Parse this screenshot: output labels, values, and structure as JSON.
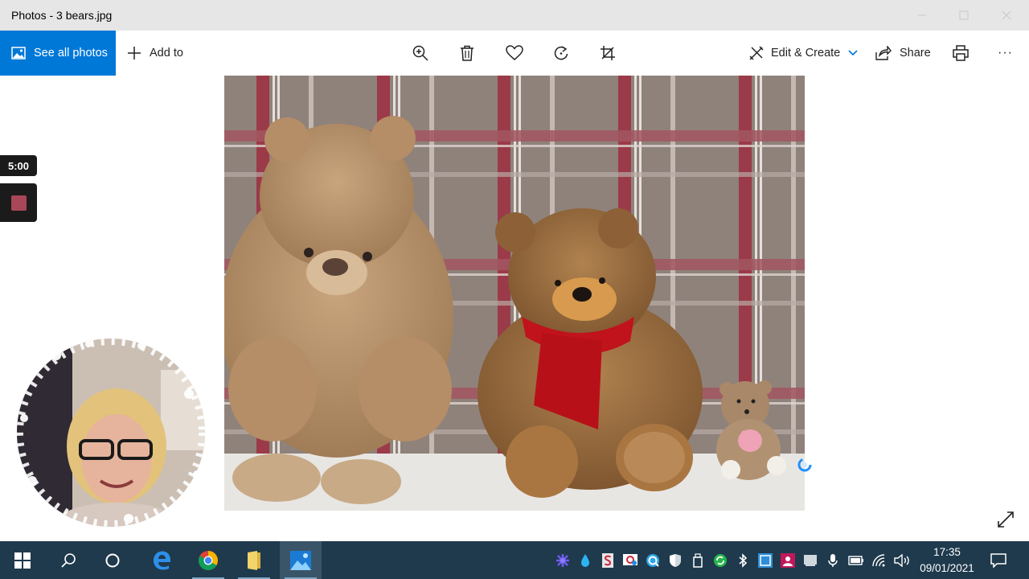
{
  "window": {
    "title": "Photos - 3 bears.jpg"
  },
  "toolbar": {
    "see_all_photos": "See all photos",
    "add_to": "Add to",
    "edit_create": "Edit & Create",
    "share": "Share",
    "more": "···"
  },
  "recorder": {
    "timer": "5:00"
  },
  "taskbar": {
    "time": "17:35",
    "date": "09/01/2021"
  },
  "colors": {
    "accent": "#0078d7",
    "taskbar": "#1f3a4d",
    "titlebar": "#e6e6e6"
  }
}
